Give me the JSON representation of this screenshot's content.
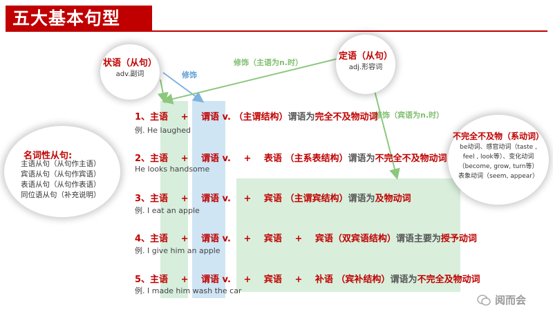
{
  "title": "五大基本句型",
  "bubbles": {
    "adverbial": {
      "title": "状语（从句）",
      "sub": "adv.副词"
    },
    "attributive": {
      "title": "定语（从句）",
      "sub": "adj.形容词"
    },
    "nominal": {
      "title": "名词性从句:",
      "items": [
        "主语从句（从句作主语）",
        "宾语从句（从句作宾语）",
        "表语从句（从句作表语）",
        "同位语从句（补充说明）"
      ]
    },
    "incomplete_intransitive": {
      "title": "不完全不及物（系动词）",
      "items": [
        "be动词、感官动词（taste ,",
        "feel , look等）、变化动词",
        "（become, grow, turn等）",
        "表象动词（seem, appear）"
      ]
    }
  },
  "notes": {
    "modify": "修饰",
    "modify_subject": "修饰（主语为n.时）",
    "modify_object": "修饰（宾语为n.时）"
  },
  "rows": [
    {
      "num": "1、",
      "subj": "主语",
      "plus1": "+",
      "pred": "谓语 v.",
      "rest1": "（主谓结构）",
      "rest2": "谓语为",
      "rest3": "完全不及物动词",
      "example": "例. He laughed"
    },
    {
      "num": "2、",
      "subj": "主语",
      "plus1": "+",
      "pred": "谓语 v.",
      "plus2": "+",
      "obj": "表语",
      "rest1": "（主系表结构）",
      "rest2": "谓语为",
      "rest3": "不完全不及物动词",
      "example": "He looks handsome"
    },
    {
      "num": "3、",
      "subj": "主语",
      "plus1": "+",
      "pred": "谓语 v.",
      "plus2": "+",
      "obj": "宾语",
      "rest1": "（主谓宾结构）",
      "rest2": "谓语为",
      "rest3": "及物动词",
      "example": "例. I eat an apple"
    },
    {
      "num": "4、",
      "subj": "主语",
      "plus1": "+",
      "pred": "谓语 v.",
      "plus2": "+",
      "obj": "宾语",
      "plus3": "+",
      "obj2": "宾语",
      "rest1": "（双宾语结构）",
      "rest2": "谓语主要为",
      "rest3": "授予动词",
      "example": "例. I give him an apple"
    },
    {
      "num": "5、",
      "subj": "主语",
      "plus1": "+",
      "pred": "谓语 v.",
      "plus2": "+",
      "obj": "宾语",
      "plus3": "+",
      "obj2": "补语",
      "rest1": "（宾补结构）",
      "rest2": "谓语为",
      "rest3": "不完全及物动词",
      "example": "例. I made him wash the car"
    }
  ],
  "watermark": "阅而会",
  "colors": {
    "accent": "#c00000",
    "note_green": "#7fbf6f",
    "note_blue": "#5d9fd6"
  }
}
